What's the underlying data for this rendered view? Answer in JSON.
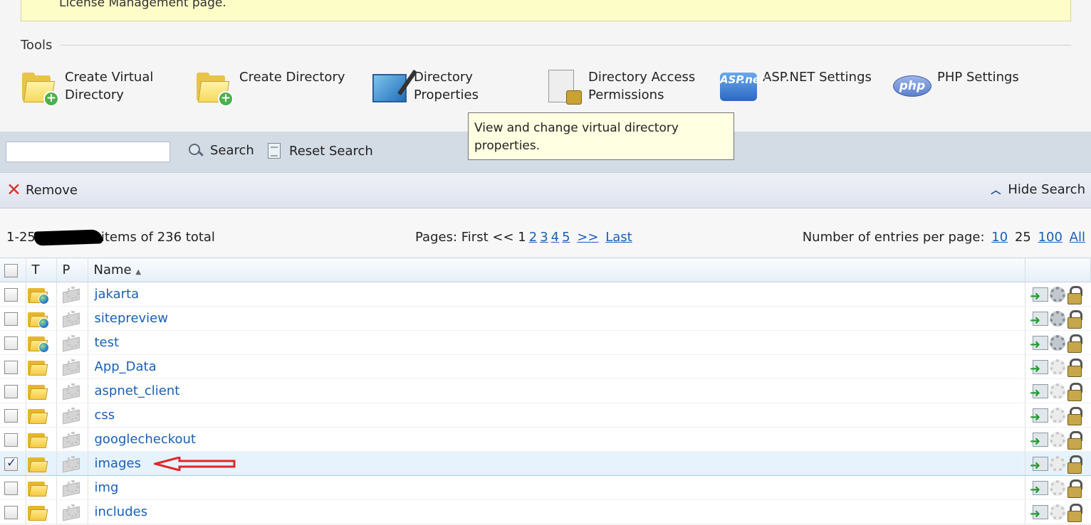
{
  "notice": {
    "text": "License Management page."
  },
  "tools": {
    "heading": "Tools",
    "items": [
      {
        "label": "Create Virtual Directory",
        "icon": "folder-add-icon"
      },
      {
        "label": "Create Directory",
        "icon": "folder-add-icon"
      },
      {
        "label": "Directory Properties",
        "icon": "directory-properties-icon"
      },
      {
        "label": "Directory Access Permissions",
        "icon": "document-lock-icon"
      },
      {
        "label": "ASP.NET Settings",
        "icon": "aspnet-icon"
      },
      {
        "label": "PHP Settings",
        "icon": "php-icon"
      }
    ],
    "aspnet_logo": "ASP.net",
    "php_logo": "php"
  },
  "tooltip": {
    "text": "View and change virtual directory properties."
  },
  "search": {
    "value": "",
    "search_label": "Search",
    "reset_label": "Reset Search"
  },
  "actions": {
    "remove_label": "Remove",
    "hide_search_label": "Hide Search"
  },
  "pager": {
    "count_prefix": "1-25",
    "count_suffix": "items of 236 total",
    "pages_label": "Pages:",
    "first": "First",
    "prev": "<<",
    "current": "1",
    "pages": [
      "2",
      "3",
      "4",
      "5"
    ],
    "next": ">>",
    "last": "Last",
    "entries_label": "Number of entries per page:",
    "entries_options": [
      "10",
      "25",
      "100",
      "All"
    ],
    "entries_current": "25"
  },
  "table": {
    "headers": {
      "type": "T",
      "perm": "P",
      "name": "Name",
      "sort_indicator": "▲"
    },
    "rows": [
      {
        "name": "jakarta",
        "type": "virtual",
        "checked": false
      },
      {
        "name": "sitepreview",
        "type": "virtual",
        "checked": false
      },
      {
        "name": "test",
        "type": "virtual",
        "checked": false
      },
      {
        "name": "App_Data",
        "type": "folder",
        "checked": false
      },
      {
        "name": "aspnet_client",
        "type": "folder",
        "checked": false
      },
      {
        "name": "css",
        "type": "folder",
        "checked": false
      },
      {
        "name": "googlecheckout",
        "type": "folder",
        "checked": false
      },
      {
        "name": "images",
        "type": "folder",
        "checked": true
      },
      {
        "name": "img",
        "type": "folder",
        "checked": false
      },
      {
        "name": "includes",
        "type": "folder",
        "checked": false
      }
    ]
  },
  "colors": {
    "link": "#1a5fb4",
    "annotation_arrow": "#e0262b",
    "selected_row": "#e6f3fd"
  }
}
